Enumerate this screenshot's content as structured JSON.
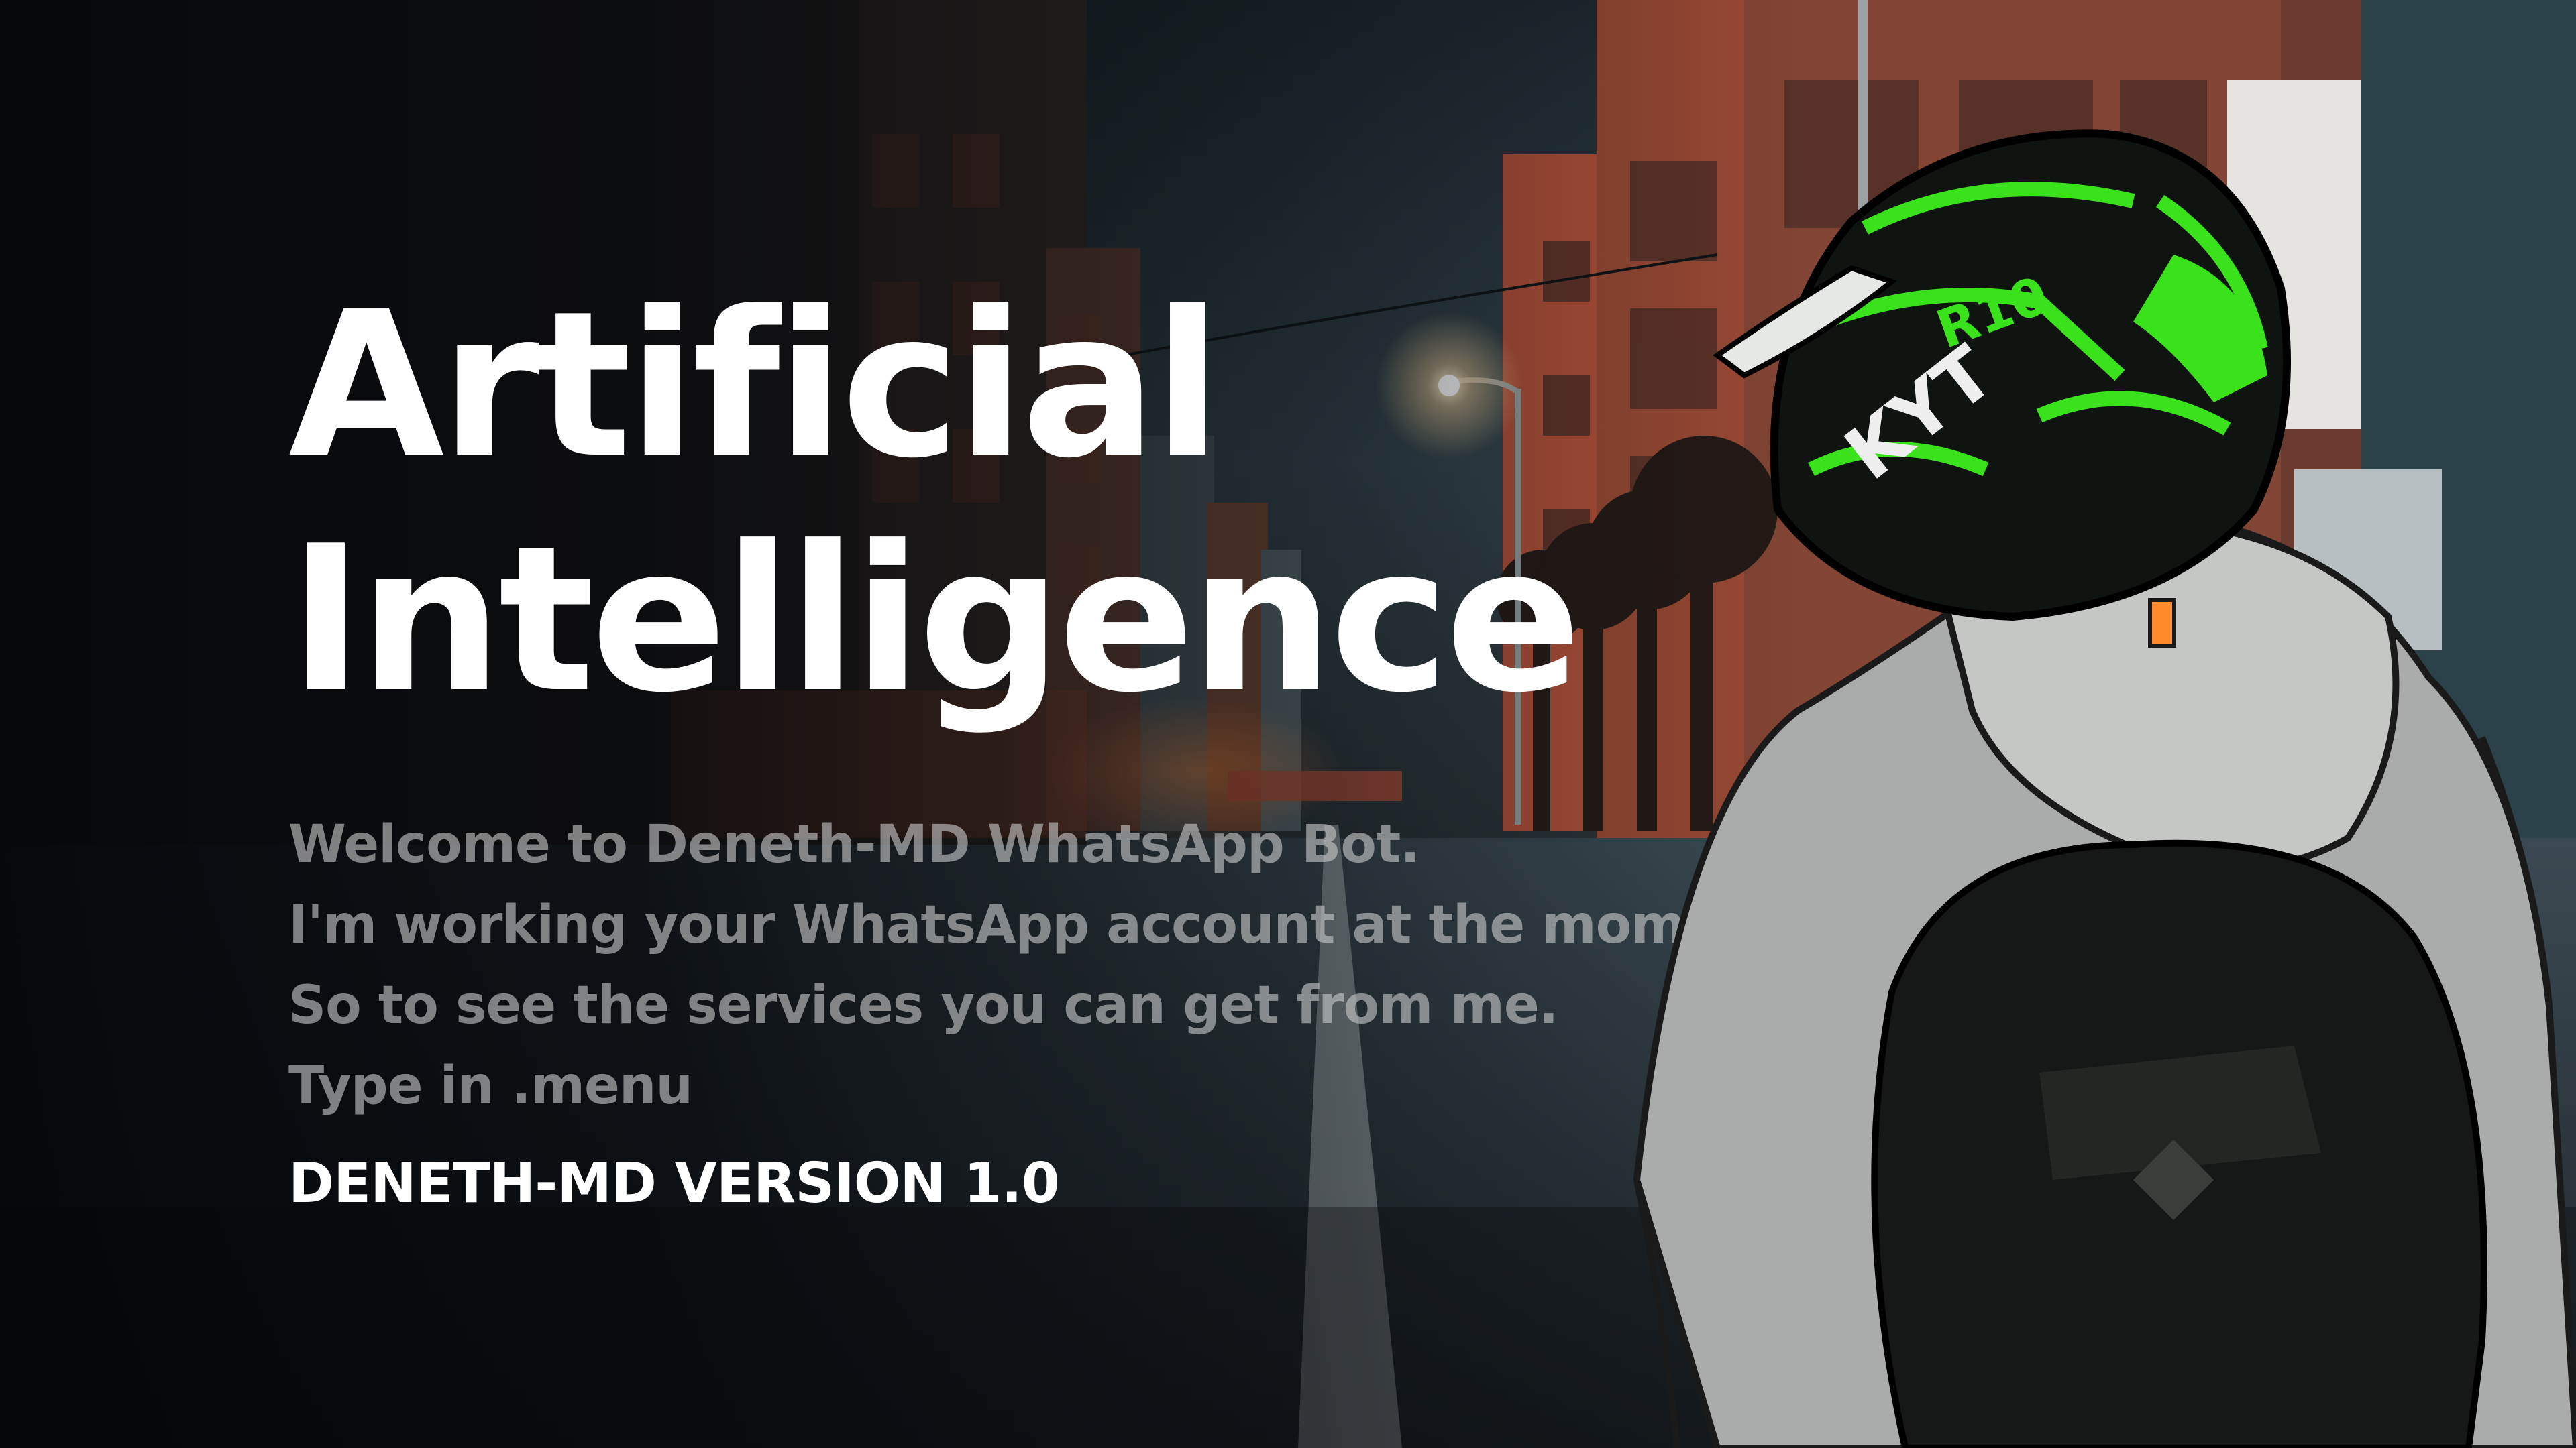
{
  "headline": {
    "line1": "Artificial",
    "line2": "Intelligence"
  },
  "welcome": {
    "line1": "Welcome to Deneth-MD WhatsApp Bot.",
    "line2": "I'm working your WhatsApp account at the moment.",
    "line3": "So to see the services you can get from me.",
    "line4": "Type in .menu"
  },
  "version_label": "DENETH-MD VERSION 1.0",
  "helmet": {
    "brand": "KYT",
    "model": "R10"
  },
  "colors": {
    "background": "#0b0d10",
    "accent_green": "#39e21a",
    "building_orange": "#b5523a",
    "hoodie_grey": "#a9acaa"
  }
}
